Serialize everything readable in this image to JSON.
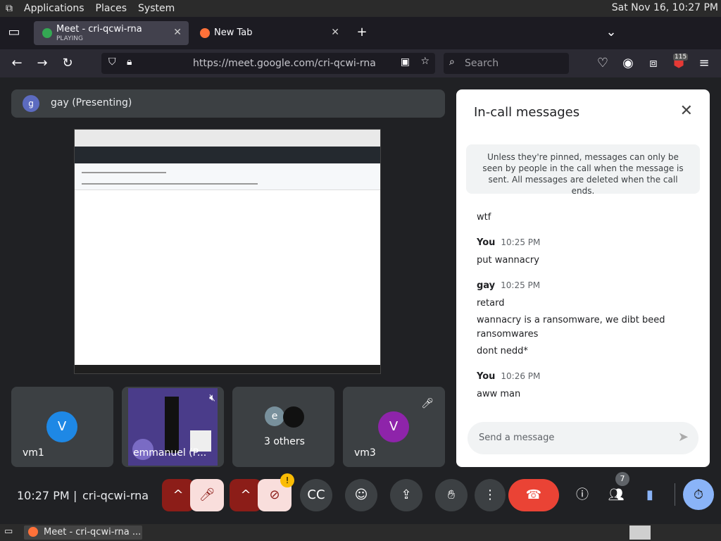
{
  "top_panel": {
    "applications": "Applications",
    "places": "Places",
    "system": "System",
    "clock": "Sat Nov 16, 10:27 PM"
  },
  "browser": {
    "tabs": [
      {
        "title": "Meet - cri-qcwi-rna",
        "subtitle": "PLAYING"
      },
      {
        "title": "New Tab"
      }
    ],
    "url": "https://meet.google.com/cri-qcwi-rna",
    "search_placeholder": "Search",
    "badge_count": "115"
  },
  "meet": {
    "presenter": {
      "initial": "g",
      "label": "gay (Presenting)"
    },
    "tiles": [
      {
        "initial": "V",
        "label": "vm1",
        "color": "#1e88e5"
      },
      {
        "label": "emmanuel (P..."
      },
      {
        "initial": "e",
        "label": "3 others"
      },
      {
        "initial": "V",
        "label": "vm3",
        "color": "#8e24aa"
      }
    ],
    "chat": {
      "title": "In-call messages",
      "notice": "Unless they're pinned, messages can only be seen by people in the call when the message is sent. All messages are deleted when the call ends.",
      "messages": [
        {
          "sender": "",
          "time": "",
          "lines": [
            "wtf"
          ]
        },
        {
          "sender": "You",
          "time": "10:25 PM",
          "lines": [
            "put wannacry"
          ]
        },
        {
          "sender": "gay",
          "time": "10:25 PM",
          "lines": [
            "retard",
            "wannacry is a ransomware, we dibt beed ransomwares",
            "dont nedd*"
          ]
        },
        {
          "sender": "You",
          "time": "10:26 PM",
          "lines": [
            "aww man"
          ]
        }
      ],
      "input_placeholder": "Send a message"
    },
    "controls": {
      "time": "10:27 PM",
      "meeting_code": "cri-qcwi-rna",
      "participants_count": "7"
    }
  },
  "taskbar": {
    "item": "Meet - cri-qcwi-rna ..."
  }
}
